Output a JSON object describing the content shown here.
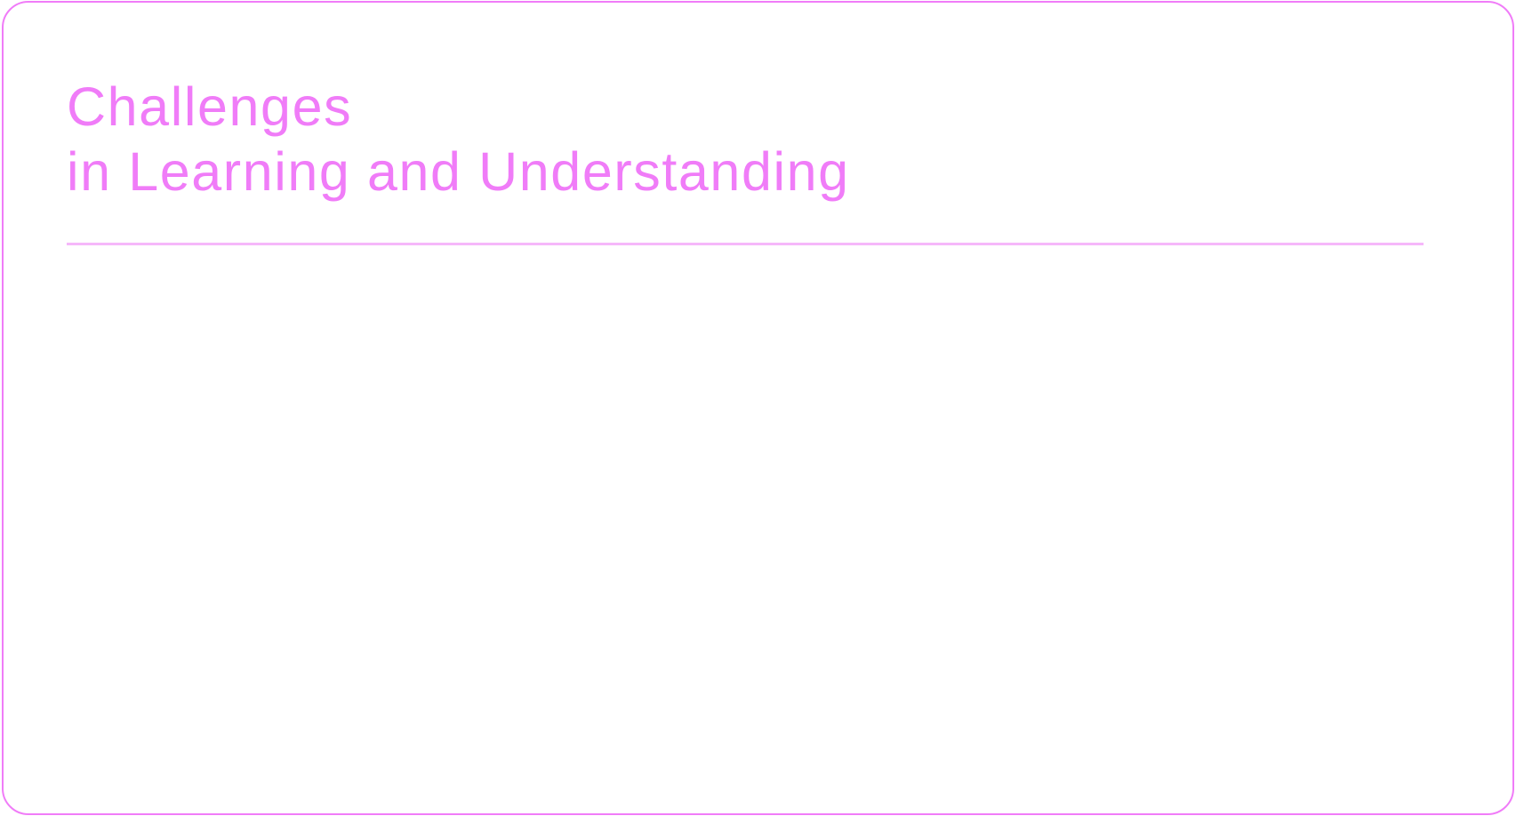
{
  "slide": {
    "title_line1": "Challenges",
    "title_line2": "in Learning and Understanding"
  },
  "colors": {
    "accent": "#f07cf8",
    "divider": "#f6b8fa"
  }
}
